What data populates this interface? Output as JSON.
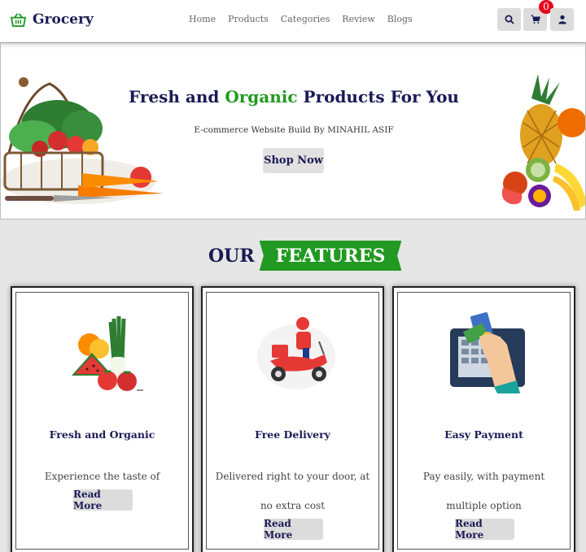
{
  "header": {
    "brand": "Grocery",
    "nav": [
      "Home",
      "Products",
      "Categories",
      "Review",
      "Blogs"
    ],
    "cart_count": "0",
    "icons": [
      "search-icon",
      "cart-icon",
      "user-icon"
    ]
  },
  "hero": {
    "title_part1": "Fresh and",
    "title_highlight": "Organic",
    "title_part2": "Products For You",
    "subtitle": "E-commerce Website Build By MINAHIL ASIF",
    "button": "Shop Now"
  },
  "features": {
    "heading_our": "OUR",
    "heading_tag": "FEATURES",
    "cards": [
      {
        "title": "Fresh and Organic",
        "desc": "Experience the taste of freshness",
        "button": "Read More",
        "icon": "vegetables-image"
      },
      {
        "title": "Free Delivery",
        "desc": "Delivered right to your door, at no extra cost",
        "button": "Read More",
        "icon": "delivery-scooter-image"
      },
      {
        "title": "Easy Payment",
        "desc": "Pay easily, with payment multiple option",
        "button": "Read More",
        "icon": "card-payment-image"
      }
    ]
  },
  "colors": {
    "brand_navy": "#1a1a55",
    "accent_green": "#229922",
    "badge_red": "#e8001c"
  }
}
